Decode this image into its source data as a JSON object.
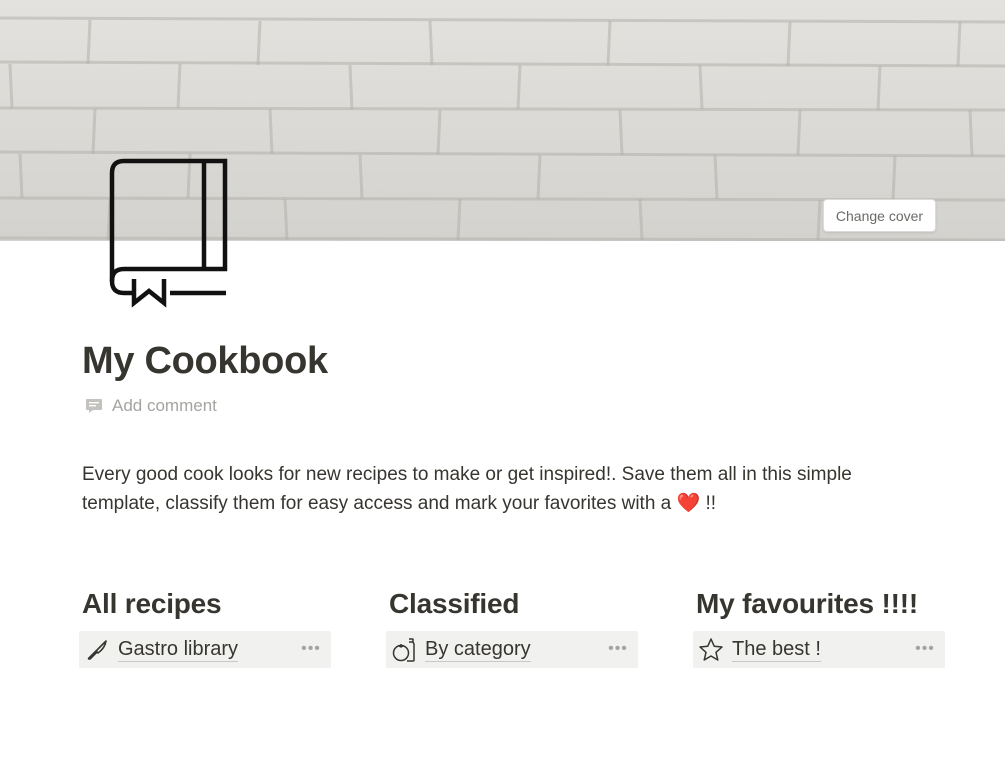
{
  "cover": {
    "change_cover_label": "Change cover",
    "background_color": "#dcdbd7"
  },
  "page": {
    "icon": "book-icon",
    "title": "My Cookbook",
    "add_comment_label": "Add comment",
    "description_text": "Every good cook looks for new recipes to make or get inspired!. Save them all in this simple template, classify them for easy access and mark your favorites with a",
    "description_heart": "❤️",
    "description_end": " !!"
  },
  "columns": [
    {
      "heading": "All recipes",
      "link_label": "Gastro library",
      "link_icon": "knife-icon",
      "more": "•••"
    },
    {
      "heading": "Classified",
      "link_label": "By category",
      "link_icon": "tomato-jar-icon",
      "more": "•••"
    },
    {
      "heading": "My favourites !!!!",
      "link_label": "The best !",
      "link_icon": "star-icon",
      "more": "•••"
    }
  ],
  "colors": {
    "text": "#37352f",
    "muted": "#a5a4a0",
    "link_bg": "#f1f1ef"
  }
}
